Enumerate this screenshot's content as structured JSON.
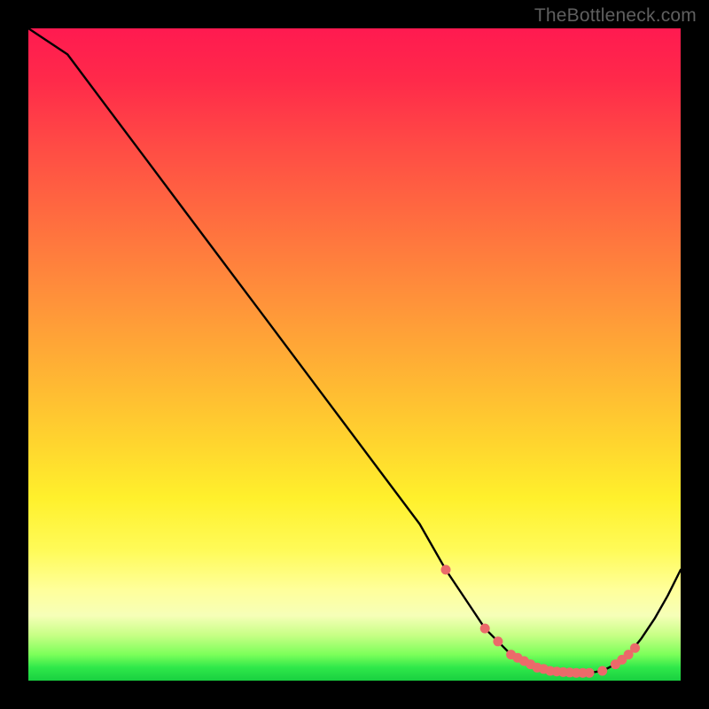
{
  "watermark": "TheBottleneck.com",
  "colors": {
    "background": "#000000",
    "line": "#000000",
    "marker": "#eb6a6a",
    "text": "#5f5f5f"
  },
  "chart_data": {
    "type": "line",
    "title": "",
    "xlabel": "",
    "ylabel": "",
    "xlim": [
      0,
      100
    ],
    "ylim": [
      0,
      100
    ],
    "x": [
      0,
      6,
      12,
      18,
      24,
      30,
      36,
      42,
      48,
      54,
      60,
      64,
      68,
      70,
      72,
      74,
      76,
      78,
      80,
      82,
      84,
      86,
      88,
      90,
      92,
      94,
      96,
      98,
      100
    ],
    "y": [
      100,
      96,
      88,
      80,
      72,
      64,
      56,
      48,
      40,
      32,
      24,
      17,
      11,
      8,
      6,
      4,
      3,
      2,
      1.5,
      1.3,
      1.2,
      1.2,
      1.5,
      2.5,
      4,
      6.5,
      9.5,
      13,
      17
    ],
    "markers": {
      "x": [
        64,
        70,
        72,
        74,
        75,
        76,
        77,
        78,
        79,
        80,
        81,
        82,
        83,
        84,
        85,
        86,
        88,
        90,
        91,
        92,
        93
      ],
      "y": [
        17,
        8,
        6,
        4,
        3.5,
        3,
        2.5,
        2,
        1.8,
        1.5,
        1.4,
        1.3,
        1.25,
        1.2,
        1.2,
        1.2,
        1.5,
        2.5,
        3.2,
        4,
        5
      ]
    }
  }
}
